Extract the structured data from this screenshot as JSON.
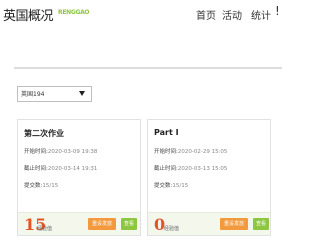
{
  "header": {
    "title": "英国概况",
    "logo_text": "RENGGAO",
    "nav": [
      "首页",
      "活动",
      "统计"
    ],
    "more": "!"
  },
  "filter": {
    "selected": "英国194"
  },
  "cards": [
    {
      "title": "第二次作业",
      "start_label": "开始时间:",
      "start_value": "2020-03-09 19:38",
      "end_label": "截止时间:",
      "end_value": "2020-03-14 19:31",
      "count_label": "提交数:",
      "count_value": "15/15",
      "score": "15",
      "score_unit": "经验值",
      "redo_label": "重设发放",
      "view_label": "查看"
    },
    {
      "title": "Part I",
      "start_label": "开始时间:",
      "start_value": "2020-02-29 15:05",
      "end_label": "截止时间:",
      "end_value": "2020-03-13 15:05",
      "count_label": "提交数:",
      "count_value": "15/15",
      "score": "0",
      "score_unit": "经验值",
      "redo_label": "重设发放",
      "view_label": "查看"
    }
  ],
  "colors": {
    "accent_green": "#8dc63f",
    "accent_orange": "#f3993e",
    "score_red": "#e85326"
  }
}
